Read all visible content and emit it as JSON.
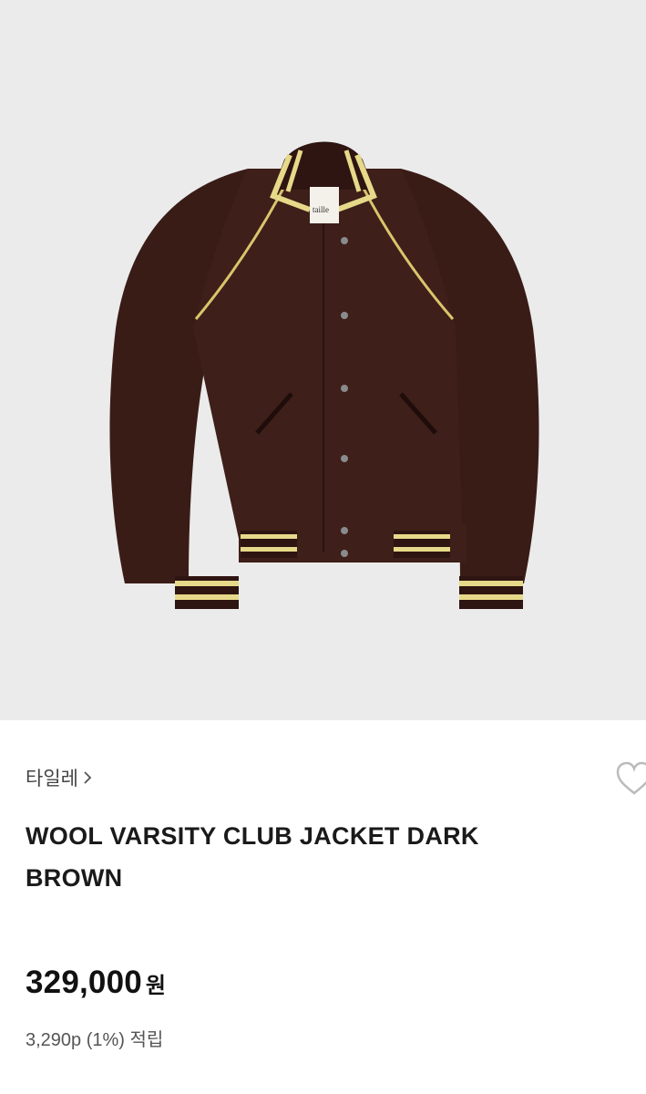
{
  "product": {
    "image_alt": "wool varsity jacket",
    "label_text": "taille"
  },
  "brand": {
    "name": "타일레"
  },
  "title": "WOOL VARSITY CLUB JACKET DARK BROWN",
  "price": {
    "amount": "329,000",
    "currency": "원"
  },
  "points": {
    "text": "3,290p (1%) 적립"
  },
  "icons": {
    "wishlist": "heart-outline-icon",
    "brand_chevron": "chevron-right-icon"
  },
  "colors": {
    "jacket": "#3a1c17",
    "stripe": "#e7d98a",
    "background": "#ebebeb"
  }
}
